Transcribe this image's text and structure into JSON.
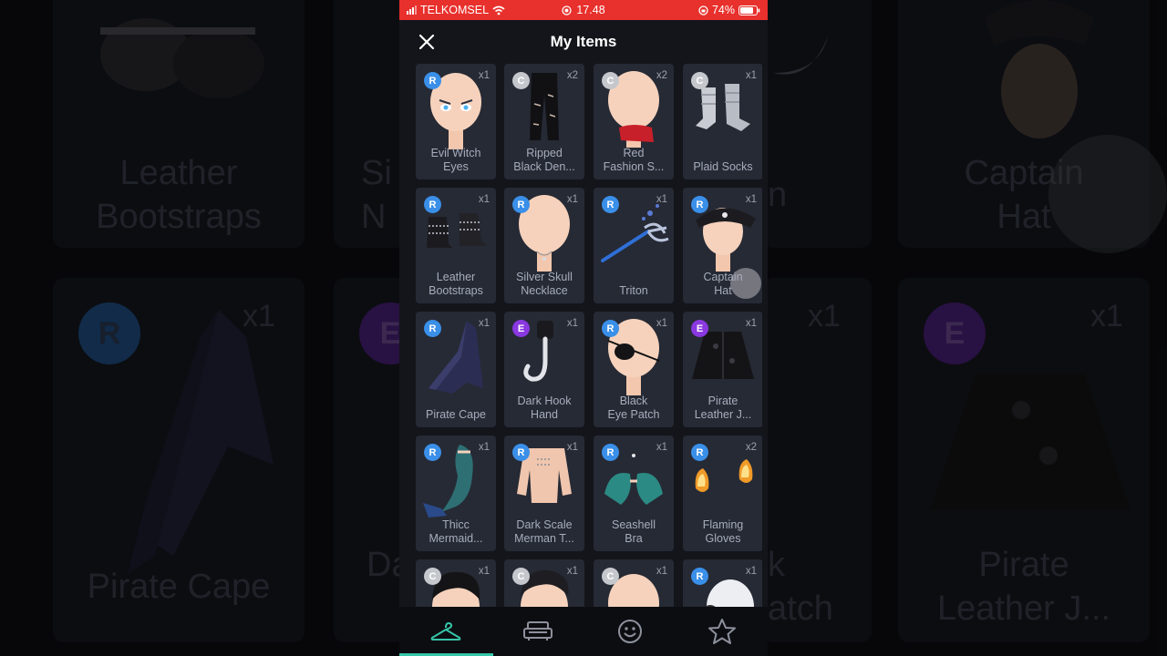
{
  "status_bar": {
    "carrier": "TELKOMSEL",
    "time": "17.48",
    "battery": "74%"
  },
  "header": {
    "title": "My Items"
  },
  "items": [
    {
      "badge": "R",
      "count": "x1",
      "line1": "Evil Witch",
      "line2": "Eyes"
    },
    {
      "badge": "C",
      "count": "x2",
      "line1": "Ripped",
      "line2": "Black Den..."
    },
    {
      "badge": "C",
      "count": "x2",
      "line1": "Red",
      "line2": "Fashion S..."
    },
    {
      "badge": "C",
      "count": "x1",
      "line1": "Plaid Socks",
      "line2": ""
    },
    {
      "badge": "R",
      "count": "x1",
      "line1": "Leather",
      "line2": "Bootstraps"
    },
    {
      "badge": "R",
      "count": "x1",
      "line1": "Silver Skull",
      "line2": "Necklace"
    },
    {
      "badge": "R",
      "count": "x1",
      "line1": "Triton",
      "line2": ""
    },
    {
      "badge": "R",
      "count": "x1",
      "line1": "Captain",
      "line2": "Hat"
    },
    {
      "badge": "R",
      "count": "x1",
      "line1": "Pirate Cape",
      "line2": ""
    },
    {
      "badge": "E",
      "count": "x1",
      "line1": "Dark Hook",
      "line2": "Hand"
    },
    {
      "badge": "R",
      "count": "x1",
      "line1": "Black",
      "line2": "Eye Patch"
    },
    {
      "badge": "E",
      "count": "x1",
      "line1": "Pirate",
      "line2": "Leather J..."
    },
    {
      "badge": "R",
      "count": "x1",
      "line1": "Thicc",
      "line2": "Mermaid..."
    },
    {
      "badge": "R",
      "count": "x1",
      "line1": "Dark Scale",
      "line2": "Merman T..."
    },
    {
      "badge": "R",
      "count": "x1",
      "line1": "Seashell",
      "line2": "Bra"
    },
    {
      "badge": "R",
      "count": "x2",
      "line1": "Flaming",
      "line2": "Gloves"
    },
    {
      "badge": "C",
      "count": "x1",
      "line1": "",
      "line2": ""
    },
    {
      "badge": "C",
      "count": "x1",
      "line1": "",
      "line2": ""
    },
    {
      "badge": "C",
      "count": "x1",
      "line1": "",
      "line2": ""
    },
    {
      "badge": "R",
      "count": "x1",
      "line1": "",
      "line2": ""
    }
  ],
  "rarity_colors": {
    "R": "#3a8fe8",
    "C": "#c4c7cc",
    "E": "#8a38e0"
  },
  "accent": "#36c4a8",
  "tabs": [
    {
      "icon": "hanger-icon",
      "active": true
    },
    {
      "icon": "sofa-icon",
      "active": false
    },
    {
      "icon": "smiley-icon",
      "active": false
    },
    {
      "icon": "star-icon",
      "active": false
    }
  ],
  "background": {
    "labels": [
      {
        "line1": "Leather",
        "line2": "Bootstraps"
      },
      {
        "line1": "Si",
        "line2": "N"
      },
      {
        "line1": "Captain",
        "line2": "Hat"
      },
      {
        "line1": "Pirate Cape",
        "line2": ""
      },
      {
        "line1": "Da",
        "line2": ""
      },
      {
        "line1": "Pirate",
        "line2": "Leather J..."
      },
      {
        "line1": "n",
        "line2": ""
      },
      {
        "line1": "k",
        "line2": "atch"
      }
    ],
    "badges": [
      "R",
      "E",
      "E"
    ],
    "counts": [
      "x1",
      "x1",
      "x1"
    ]
  }
}
